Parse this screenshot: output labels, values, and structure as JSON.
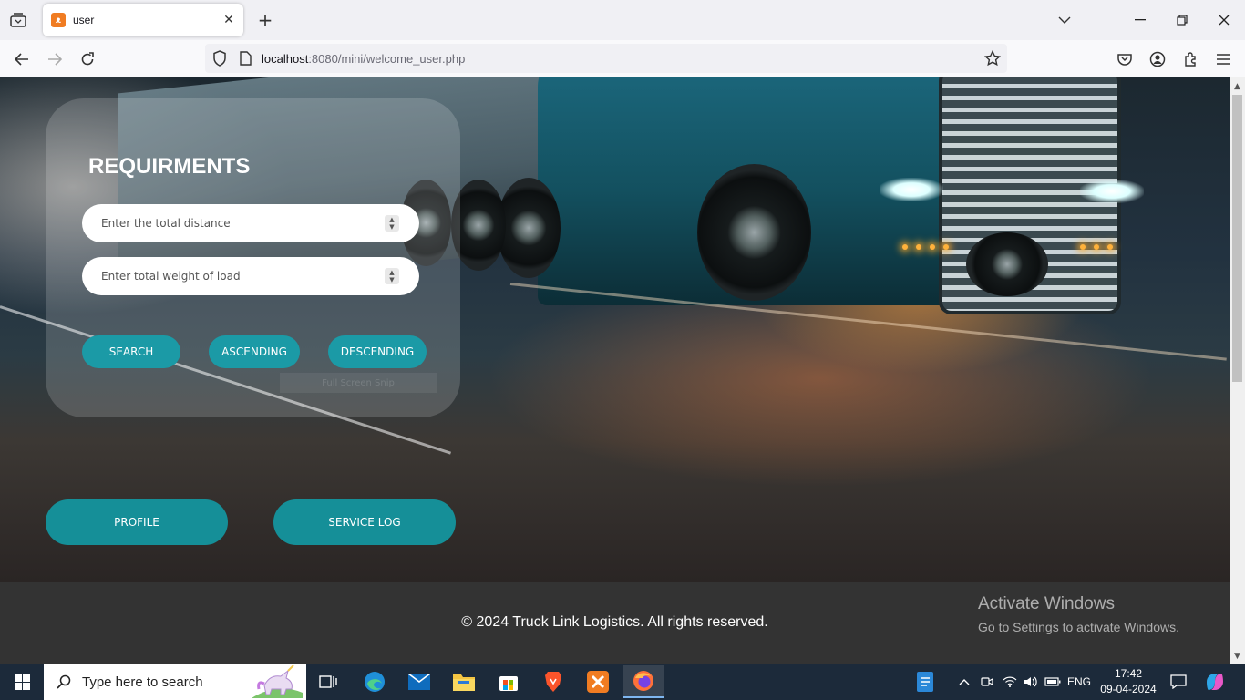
{
  "browser": {
    "tab_title": "user",
    "tab_favicon": "xampp-icon",
    "url_host": "localhost",
    "url_rest": ":8080/mini/welcome_user.php"
  },
  "page": {
    "requirements_title": "REQUIRMENTS",
    "distance_placeholder": "Enter the total distance",
    "weight_placeholder": "Enter total weight of load",
    "search_label": "SEARCH",
    "ascending_label": "ASCENDING",
    "descending_label": "DESCENDING",
    "ghost_text": "Full Screen Snip",
    "profile_label": "PROFILE",
    "service_log_label": "SERVICE LOG",
    "footer_text": "© 2024 Truck Link Logistics. All rights reserved."
  },
  "watermark": {
    "line1": "Activate Windows",
    "line2": "Go to Settings to activate Windows."
  },
  "taskbar": {
    "search_text": "Type here to search",
    "language": "ENG",
    "time": "17:42",
    "date": "09-04-2024"
  },
  "colors": {
    "button_teal": "#1b9aa6",
    "footer_bg": "#333333",
    "taskbar_bg": "#1c2a3a"
  }
}
